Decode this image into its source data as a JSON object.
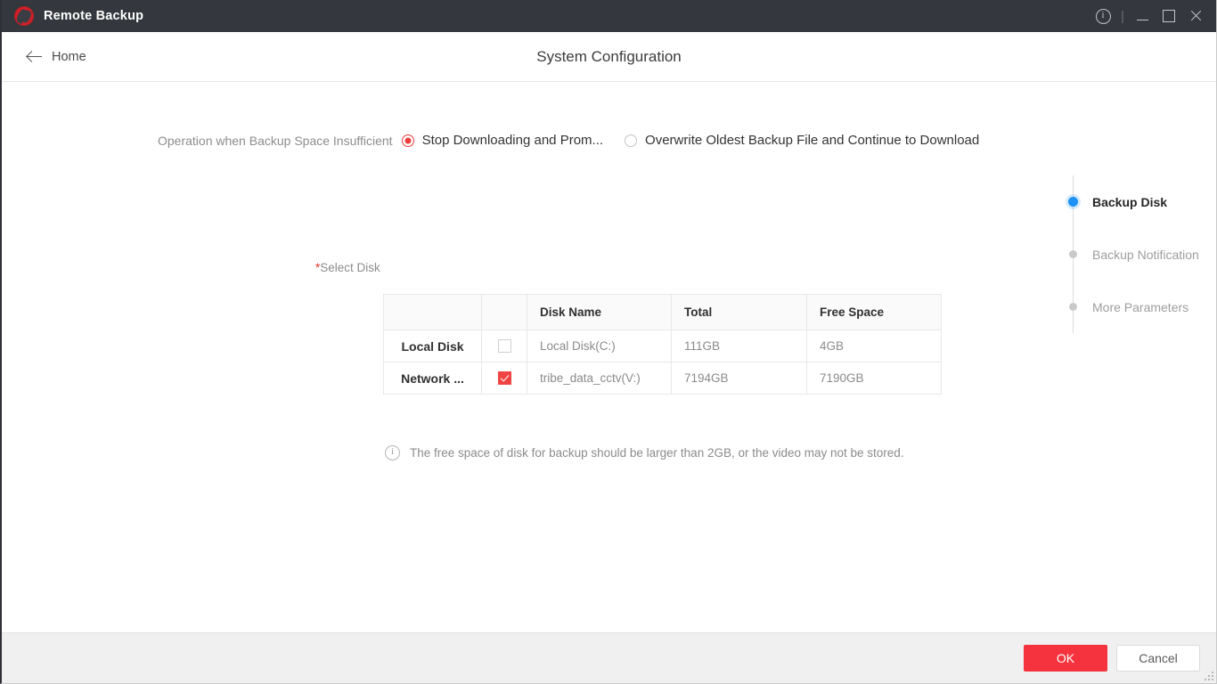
{
  "titlebar": {
    "app_title": "Remote Backup",
    "logo_icon": "remote-backup-logo",
    "info_icon": "info-icon",
    "separator": "|",
    "minimize_icon": "minimize-icon",
    "maximize_icon": "maximize-icon",
    "close_icon": "close-icon",
    "background": "#34373d"
  },
  "header": {
    "back_icon": "arrow-left-icon",
    "home_label": "Home",
    "page_title": "System Configuration"
  },
  "main": {
    "operation": {
      "label": "Operation when Backup Space Insufficient",
      "options": [
        {
          "label": "Stop Downloading and Prom...",
          "selected": true
        },
        {
          "label": "Overwrite Oldest Backup File and Continue to Download",
          "selected": false
        }
      ]
    },
    "select_disk": {
      "required_mark": "*",
      "label": "Select Disk"
    },
    "table": {
      "headers": [
        "",
        "",
        "Disk Name",
        "Total",
        "Free Space"
      ],
      "rows": [
        {
          "type": "Local Disk",
          "checked": false,
          "disk_name": "Local Disk(C:)",
          "total": "111GB",
          "free_space": "4GB"
        },
        {
          "type": "Network ...",
          "checked": true,
          "disk_name": "tribe_data_cctv(V:)",
          "total": "7194GB",
          "free_space": "7190GB"
        }
      ]
    },
    "note": {
      "icon": "info-circle-icon",
      "text": "The free space of disk for backup should be larger than 2GB, or the video may not be stored."
    }
  },
  "stepper": {
    "steps": [
      {
        "label": "Backup Disk",
        "active": true
      },
      {
        "label": "Backup Notification",
        "active": false
      },
      {
        "label": "More Parameters",
        "active": false
      }
    ],
    "active_color": "#1e91f5",
    "inactive_color": "#c9c9c9"
  },
  "footer": {
    "ok_label": "OK",
    "cancel_label": "Cancel",
    "ok_color": "#f5333f",
    "resize_grip": "resize-grip-icon"
  }
}
